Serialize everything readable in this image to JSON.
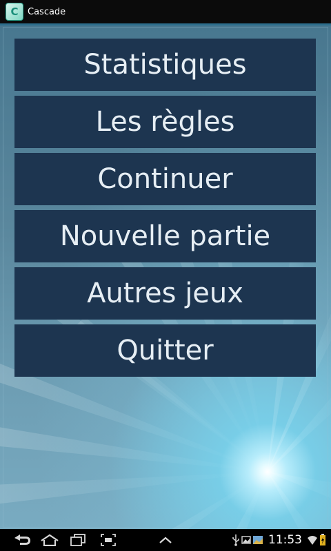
{
  "titlebar": {
    "app_icon_glyph": "C",
    "title": "Cascade"
  },
  "menu": {
    "items": [
      {
        "id": "stats",
        "label": "Statistiques"
      },
      {
        "id": "rules",
        "label": "Les règles"
      },
      {
        "id": "continue",
        "label": "Continuer"
      },
      {
        "id": "new_game",
        "label": "Nouvelle partie"
      },
      {
        "id": "other_games",
        "label": "Autres jeux"
      },
      {
        "id": "quit",
        "label": "Quitter"
      }
    ]
  },
  "navbar": {
    "buttons": [
      "back-icon",
      "home-icon",
      "recent-apps-icon",
      "screenshot-icon",
      "menu-up-icon"
    ],
    "status_icons": [
      "usb-icon",
      "image-icon",
      "photo-icon",
      "wifi-icon",
      "battery-charging-icon"
    ],
    "clock": "11:53"
  },
  "colors": {
    "button_bg": "#1d3550",
    "button_text": "#e6eef4",
    "titlebar_bg": "#0b0b0b",
    "accent_line": "#2d6e8c",
    "background_top": "#48778f",
    "starburst": "#ffffff"
  }
}
